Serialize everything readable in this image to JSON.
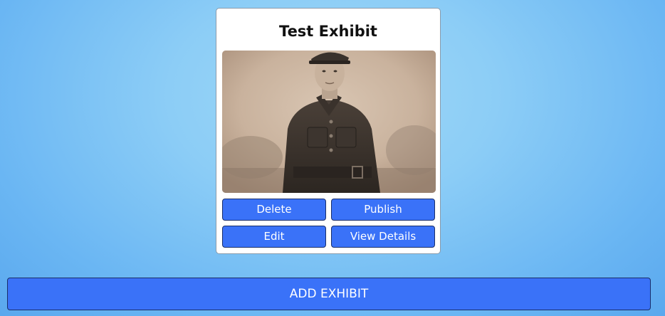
{
  "exhibit_card": {
    "title": "Test Exhibit",
    "image_alt": "soldier-portrait-photo",
    "buttons": {
      "delete": "Delete",
      "publish": "Publish",
      "edit": "Edit",
      "view_details": "View Details"
    }
  },
  "add_exhibit_label": "ADD EXHIBIT",
  "colors": {
    "button_bg": "#3a72f8",
    "button_text": "#ffffff",
    "background": "#8ccdf6",
    "card_bg": "#ffffff"
  }
}
